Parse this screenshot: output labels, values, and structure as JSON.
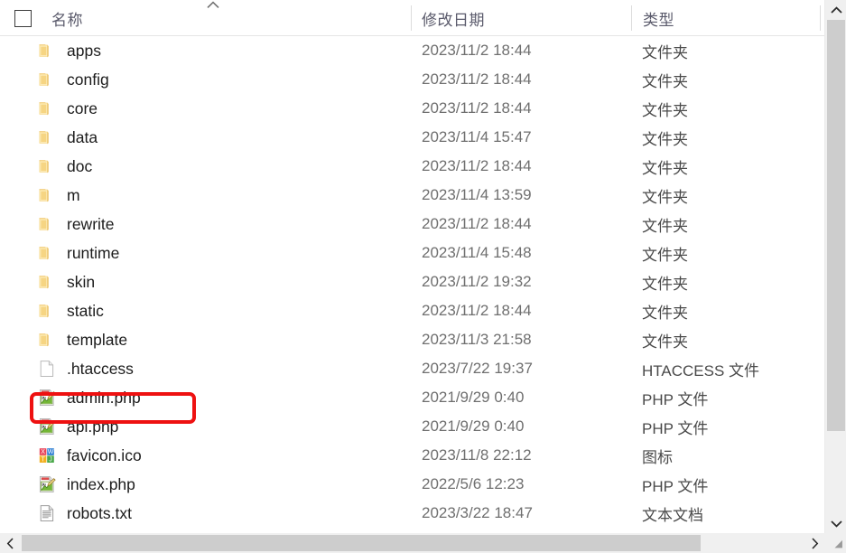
{
  "window": {
    "kind": "file-explorer-details-view"
  },
  "columns": {
    "name": "名称",
    "date_modified": "修改日期",
    "type": "类型",
    "sort_indicator": "chevron-up-icon",
    "sorted_by": "名称"
  },
  "rows": [
    {
      "name": "apps",
      "icon": "folder-icon",
      "date": "2023/11/2 18:44",
      "type": "文件夹"
    },
    {
      "name": "config",
      "icon": "folder-icon",
      "date": "2023/11/2 18:44",
      "type": "文件夹"
    },
    {
      "name": "core",
      "icon": "folder-icon",
      "date": "2023/11/2 18:44",
      "type": "文件夹"
    },
    {
      "name": "data",
      "icon": "folder-icon",
      "date": "2023/11/4 15:47",
      "type": "文件夹"
    },
    {
      "name": "doc",
      "icon": "folder-icon",
      "date": "2023/11/2 18:44",
      "type": "文件夹"
    },
    {
      "name": "m",
      "icon": "folder-icon",
      "date": "2023/11/4 13:59",
      "type": "文件夹"
    },
    {
      "name": "rewrite",
      "icon": "folder-icon",
      "date": "2023/11/2 18:44",
      "type": "文件夹"
    },
    {
      "name": "runtime",
      "icon": "folder-icon",
      "date": "2023/11/4 15:48",
      "type": "文件夹"
    },
    {
      "name": "skin",
      "icon": "folder-icon",
      "date": "2023/11/2 19:32",
      "type": "文件夹"
    },
    {
      "name": "static",
      "icon": "folder-icon",
      "date": "2023/11/2 18:44",
      "type": "文件夹"
    },
    {
      "name": "template",
      "icon": "folder-icon",
      "date": "2023/11/3 21:58",
      "type": "文件夹"
    },
    {
      "name": ".htaccess",
      "icon": "blank-document-icon",
      "date": "2023/7/22 19:37",
      "type": "HTACCESS 文件"
    },
    {
      "name": "admin.php",
      "icon": "php-notepadpp-icon",
      "date": "2021/9/29 0:40",
      "type": "PHP 文件"
    },
    {
      "name": "api.php",
      "icon": "php-notepadpp-icon",
      "date": "2021/9/29 0:40",
      "type": "PHP 文件"
    },
    {
      "name": "favicon.ico",
      "icon": "ico-tiles-icon",
      "date": "2023/11/8 22:12",
      "type": "图标"
    },
    {
      "name": "index.php",
      "icon": "php-notepadpp-icon",
      "date": "2022/5/6 12:23",
      "type": "PHP 文件"
    },
    {
      "name": "robots.txt",
      "icon": "text-document-icon",
      "date": "2023/3/22 18:47",
      "type": "文本文档"
    }
  ],
  "annotation": {
    "target_row_name": "admin.php",
    "shape": "rounded-rectangle",
    "color": "#ee1111"
  },
  "scrollbars": {
    "vertical": {
      "up_arrow": "chevron-up-icon",
      "down_arrow": "chevron-down-icon",
      "thumb": "vertical-scroll-thumb"
    },
    "horizontal": {
      "left_arrow": "chevron-left-icon",
      "right_arrow": "chevron-right-icon",
      "thumb": "horizontal-scroll-thumb"
    },
    "resize_grip": "resize-grip-icon"
  },
  "glyphs": {
    "chevron_up": "∧",
    "chevron_down": "∨",
    "chevron_left": "‹",
    "chevron_right": "›",
    "grip": "◢"
  }
}
